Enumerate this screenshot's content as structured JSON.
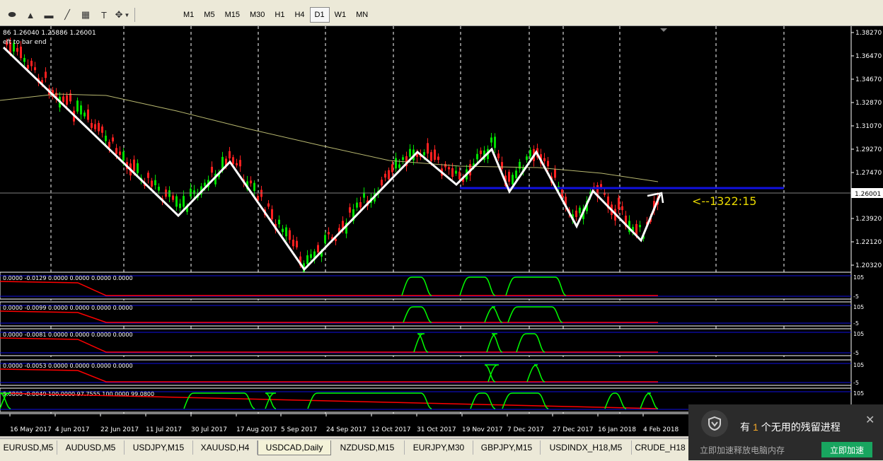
{
  "toolbar": {
    "tools": [
      {
        "icon": "ellipse-icon",
        "glyph": "⬬"
      },
      {
        "icon": "triangle-icon",
        "glyph": "▲"
      },
      {
        "icon": "rectangle-icon",
        "glyph": "▬"
      },
      {
        "icon": "trendline-icon",
        "glyph": "╱"
      },
      {
        "icon": "fibonacci-icon",
        "glyph": "▦"
      },
      {
        "icon": "text-icon",
        "glyph": "T"
      },
      {
        "icon": "shapes-icon",
        "glyph": "✥"
      }
    ],
    "timeframes": [
      "M1",
      "M5",
      "M15",
      "M30",
      "H1",
      "H4",
      "D1",
      "W1",
      "MN"
    ],
    "active_timeframe": "D1"
  },
  "chart": {
    "info_line": "86 1.26040 1.25886 1.26001",
    "info_line2": "eft to bar end",
    "annotation": "<--1322:15",
    "price_labels": [
      "1.38270",
      "1.36470",
      "1.34670",
      "1.32870",
      "1.31070",
      "1.29270",
      "1.27470",
      "1.25720",
      "1.23920",
      "1.22120",
      "1.20320"
    ],
    "current_price": "1.26001",
    "date_labels": [
      "16 May 2017",
      "4 Jun 2017",
      "22 Jun 2017",
      "11 Jul 2017",
      "30 Jul 2017",
      "17 Aug 2017",
      "5 Sep 2017",
      "24 Sep 2017",
      "12 Oct 2017",
      "31 Oct 2017",
      "19 Nov 2017",
      "7 Dec 2017",
      "27 Dec 2017",
      "16 Jan 2018",
      "4 Feb 2018"
    ],
    "colors": {
      "bull": "#00e000",
      "bear": "#ff2020",
      "ma": "#b8b870",
      "trend": "#ffffff",
      "level": "#1010e0",
      "annotation": "#e8d800",
      "indicator_up": "#00ff00",
      "indicator_down": "#ff0000"
    }
  },
  "indicators": [
    {
      "values_text": "0.0000 -0.0129 0.0000 0.0000 0.0000 0.0000",
      "level_top": "105",
      "level_bottom": "-5"
    },
    {
      "values_text": "0.0000 -0.0099 0.0000 0.0000 0.0000 0.0000",
      "level_top": "105",
      "level_bottom": "-5"
    },
    {
      "values_text": "0.0000 -0.0081 0.0000 0.0000 0.0000 0.0000",
      "level_top": "105",
      "level_bottom": "-5"
    },
    {
      "values_text": "0.0000 -0.0053 0.0000 0.0000 0.0000 0.0000",
      "level_top": "105",
      "level_bottom": "-5"
    },
    {
      "values_text": "9.0800 -0.0049 100.0000 97.7555 100.0000 99.0800",
      "level_top": "105",
      "level_bottom": ""
    }
  ],
  "tabs": [
    "EURUSD,M5",
    "AUDUSD,M5",
    "USDJPY,M15",
    "XAUUSD,H4",
    "USDCAD,Daily",
    "NZDUSD,M15",
    "EURJPY,M30",
    "GBPJPY,M15",
    "USDINDX_H18,M5",
    "CRUDE_H18"
  ],
  "active_tab": "USDCAD,Daily",
  "popup": {
    "prefix": "有",
    "count": "1",
    "suffix": "个无用的残留进程",
    "sub_text": "立即加速释放电脑内存",
    "button": "立即加速",
    "close": "✕"
  }
}
